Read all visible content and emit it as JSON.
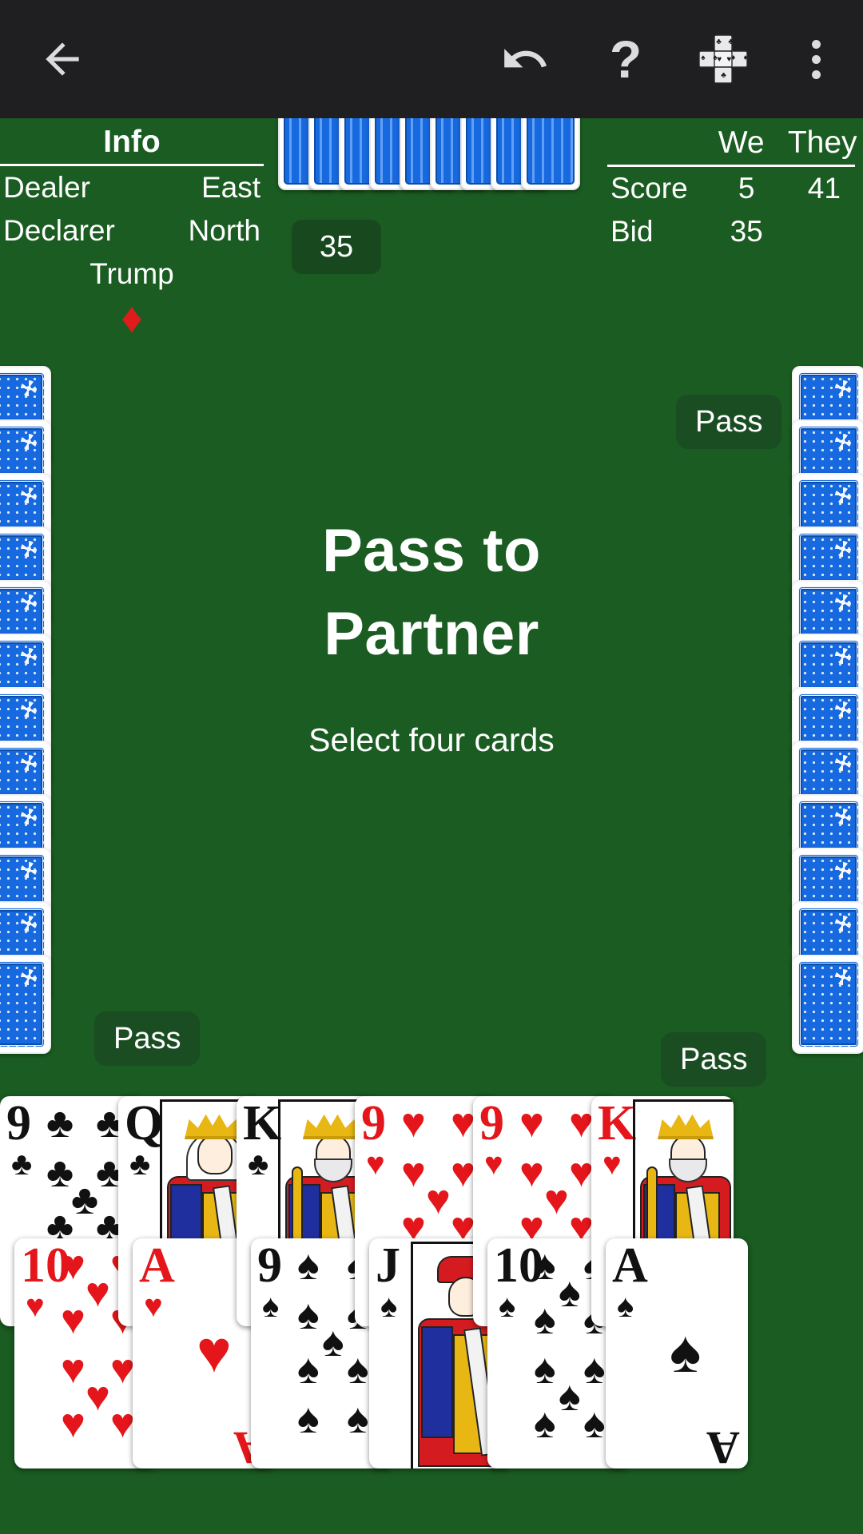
{
  "appbar": {
    "back_icon": "arrow-left-icon",
    "undo_icon": "undo-icon",
    "help_icon": "?",
    "cards_icon": "cards-cross-icon",
    "more_icon": "overflow-menu-icon"
  },
  "info": {
    "title": "Info",
    "rows": [
      {
        "label": "Dealer",
        "value": "East"
      },
      {
        "label": "Declarer",
        "value": "North"
      }
    ],
    "trump_label": "Trump",
    "trump_suit": "♦",
    "trump_suit_name": "diamonds",
    "trump_color": "#e01b1b"
  },
  "score": {
    "col_we": "We",
    "col_they": "They",
    "rows": [
      {
        "label": "Score",
        "we": "5",
        "they": "41"
      },
      {
        "label": "Bid",
        "we": "35",
        "they": ""
      }
    ]
  },
  "bid_chip": {
    "value": "35"
  },
  "pass_chips": {
    "north": "Pass",
    "south": "Pass",
    "east": "Pass"
  },
  "center": {
    "title_line_1": "Pass to",
    "title_line_2": "Partner",
    "subtitle": "Select four cards"
  },
  "deck": {
    "count": 9
  },
  "opponent_hands": {
    "west_count": 12,
    "east_count": 12
  },
  "player_hand": {
    "rows": [
      [
        {
          "rank": "9",
          "suit": "♣",
          "suit_name": "clubs",
          "color": "black",
          "face": false
        },
        {
          "rank": "Q",
          "suit": "♣",
          "suit_name": "clubs",
          "color": "black",
          "face": true,
          "face_kind": "queen"
        },
        {
          "rank": "K",
          "suit": "♣",
          "suit_name": "clubs",
          "color": "black",
          "face": true,
          "face_kind": "king"
        },
        {
          "rank": "9",
          "suit": "♥",
          "suit_name": "hearts",
          "color": "red",
          "face": false
        },
        {
          "rank": "9",
          "suit": "♥",
          "suit_name": "hearts",
          "color": "red",
          "face": false
        },
        {
          "rank": "K",
          "suit": "♥",
          "suit_name": "hearts",
          "color": "red",
          "face": true,
          "face_kind": "king"
        }
      ],
      [
        {
          "rank": "10",
          "suit": "♥",
          "suit_name": "hearts",
          "color": "red",
          "face": false
        },
        {
          "rank": "A",
          "suit": "♥",
          "suit_name": "hearts",
          "color": "red",
          "face": false,
          "ace": true
        },
        {
          "rank": "9",
          "suit": "♠",
          "suit_name": "spades",
          "color": "black",
          "face": false
        },
        {
          "rank": "J",
          "suit": "♠",
          "suit_name": "spades",
          "color": "black",
          "face": true,
          "face_kind": "jack"
        },
        {
          "rank": "10",
          "suit": "♠",
          "suit_name": "spades",
          "color": "black",
          "face": false
        },
        {
          "rank": "A",
          "suit": "♠",
          "suit_name": "spades",
          "color": "black",
          "face": false,
          "ace": true
        }
      ]
    ]
  },
  "colors": {
    "table_green": "#1a5c21",
    "appbar": "#1f1f22",
    "chip_green": "#1b4d23",
    "card_back_blue": "#1769e0",
    "red_suit": "#e4161b"
  }
}
